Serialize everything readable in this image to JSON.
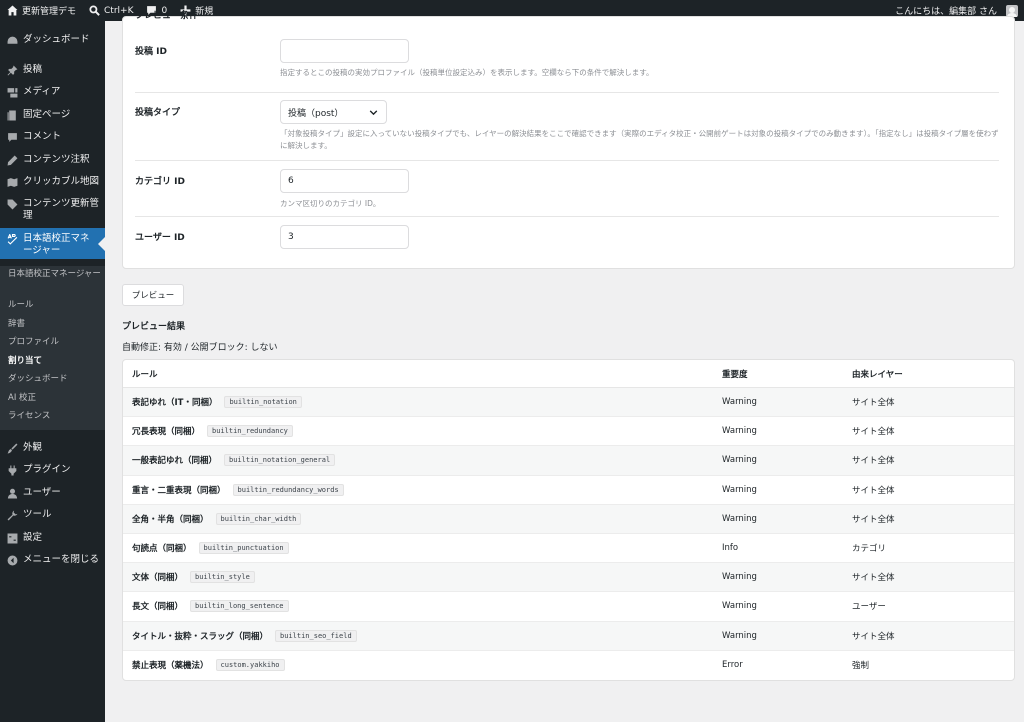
{
  "admin_bar": {
    "site_name": "更新管理デモ",
    "search_shortcut": "Ctrl+K",
    "comment_count": "0",
    "new_label": "新規",
    "greeting": "こんにちは、編集部 さん"
  },
  "sidebar": {
    "items": [
      {
        "label": "ダッシュボード",
        "icon": "dashboard-icon"
      },
      {
        "label": "投稿",
        "icon": "pin-icon"
      },
      {
        "label": "メディア",
        "icon": "media-icon"
      },
      {
        "label": "固定ページ",
        "icon": "page-icon"
      },
      {
        "label": "コメント",
        "icon": "comment-icon"
      },
      {
        "label": "コンテンツ注釈",
        "icon": "pencil-icon"
      },
      {
        "label": "クリッカブル地図",
        "icon": "map-icon"
      },
      {
        "label": "コンテンツ更新管理",
        "icon": "tag-icon"
      },
      {
        "label": "日本語校正マネージャー",
        "icon": "spellcheck-icon"
      },
      {
        "label": "外観",
        "icon": "brush-icon"
      },
      {
        "label": "プラグイン",
        "icon": "plugin-icon"
      },
      {
        "label": "ユーザー",
        "icon": "user-icon"
      },
      {
        "label": "ツール",
        "icon": "wrench-icon"
      },
      {
        "label": "設定",
        "icon": "settings-icon"
      },
      {
        "label": "メニューを閉じる",
        "icon": "collapse-icon"
      }
    ],
    "submenu": [
      "日本語校正マネージャー",
      "ルール",
      "辞書",
      "プロファイル",
      "割り当て",
      "ダッシュボード",
      "AI 校正",
      "ライセンス"
    ]
  },
  "preview_conditions": {
    "title": "プレビュー条件",
    "post_id": {
      "label": "投稿 ID",
      "value": "",
      "desc": "指定するとこの投稿の実効プロファイル（投稿単位設定込み）を表示します。空欄なら下の条件で解決します。"
    },
    "post_type": {
      "label": "投稿タイプ",
      "value": "投稿（post）",
      "desc": "「対象投稿タイプ」設定に入っていない投稿タイプでも、レイヤーの解決結果をここで確認できます（実際のエディタ校正・公開前ゲートは対象の投稿タイプでのみ動きます）。「指定なし」は投稿タイプ層を使わずに解決します。"
    },
    "category_id": {
      "label": "カテゴリ ID",
      "value": "6",
      "desc": "カンマ区切りのカテゴリ ID。"
    },
    "user_id": {
      "label": "ユーザー ID",
      "value": "3"
    }
  },
  "preview_button": "プレビュー",
  "results": {
    "heading": "プレビュー結果",
    "mode_line": "自動修正: 有効 / 公開ブロック: しない",
    "columns": [
      "ルール",
      "重要度",
      "由来レイヤー"
    ],
    "rows": [
      {
        "name": "表記ゆれ（IT・同梱）",
        "code": "builtin_notation",
        "severity": "Warning",
        "layer": "サイト全体"
      },
      {
        "name": "冗長表現（同梱）",
        "code": "builtin_redundancy",
        "severity": "Warning",
        "layer": "サイト全体"
      },
      {
        "name": "一般表記ゆれ（同梱）",
        "code": "builtin_notation_general",
        "severity": "Warning",
        "layer": "サイト全体"
      },
      {
        "name": "重言・二重表現（同梱）",
        "code": "builtin_redundancy_words",
        "severity": "Warning",
        "layer": "サイト全体"
      },
      {
        "name": "全角・半角（同梱）",
        "code": "builtin_char_width",
        "severity": "Warning",
        "layer": "サイト全体"
      },
      {
        "name": "句読点（同梱）",
        "code": "builtin_punctuation",
        "severity": "Info",
        "layer": "カテゴリ"
      },
      {
        "name": "文体（同梱）",
        "code": "builtin_style",
        "severity": "Warning",
        "layer": "サイト全体"
      },
      {
        "name": "長文（同梱）",
        "code": "builtin_long_sentence",
        "severity": "Warning",
        "layer": "ユーザー"
      },
      {
        "name": "タイトル・抜粋・スラッグ（同梱）",
        "code": "builtin_seo_field",
        "severity": "Warning",
        "layer": "サイト全体"
      },
      {
        "name": "禁止表現（薬機法）",
        "code": "custom.yakkiho",
        "severity": "Error",
        "layer": "強制"
      }
    ]
  }
}
